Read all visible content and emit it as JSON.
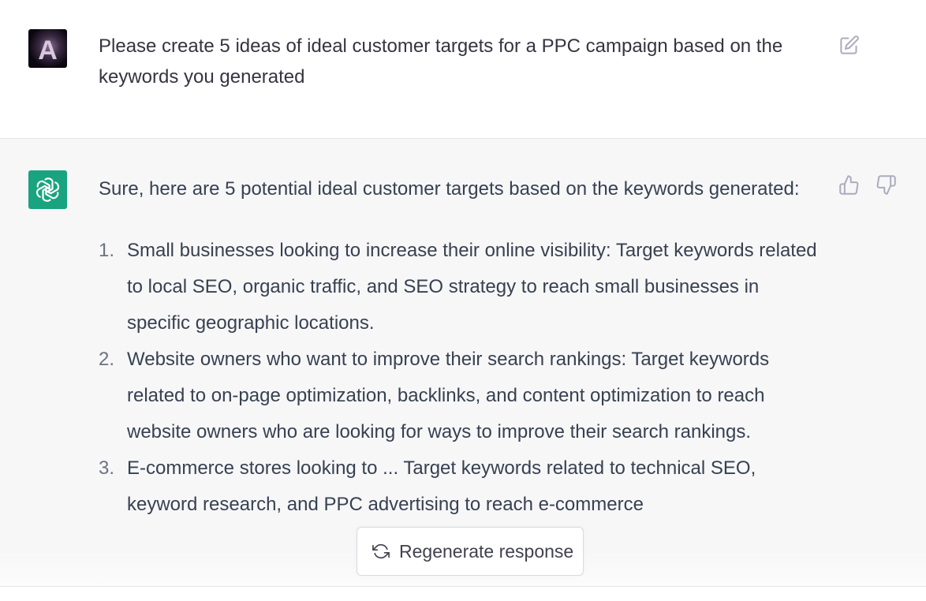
{
  "user_message": {
    "text": "Please create 5 ideas of ideal customer targets for a PPC campaign based on the keywords you generated",
    "avatar_letter": "A"
  },
  "assistant_message": {
    "intro": "Sure, here are 5 potential ideal customer targets based on the keywords generated:",
    "items": [
      {
        "num": "1.",
        "text": "Small businesses looking to increase their online visibility: Target keywords related to local SEO, organic traffic, and SEO strategy to reach small businesses in specific geographic locations."
      },
      {
        "num": "2.",
        "text": "Website owners who want to improve their search rankings: Target keywords related to on-page optimization, backlinks, and content optimization to reach website owners who are looking for ways to improve their search rankings."
      },
      {
        "num": "3.",
        "text": "E-commerce stores looking to ... Target keywords related to technical SEO, keyword research, and PPC advertising to reach e-commerce"
      }
    ]
  },
  "regenerate": {
    "label": "Regenerate response"
  },
  "colors": {
    "assistant_bg": "#f7f7f8",
    "bot_avatar": "#19a37f",
    "text": "#374151",
    "icon": "#acacbe"
  },
  "icons": [
    "edit-icon",
    "thumbs-up-icon",
    "thumbs-down-icon",
    "openai-logo-icon",
    "refresh-icon"
  ]
}
